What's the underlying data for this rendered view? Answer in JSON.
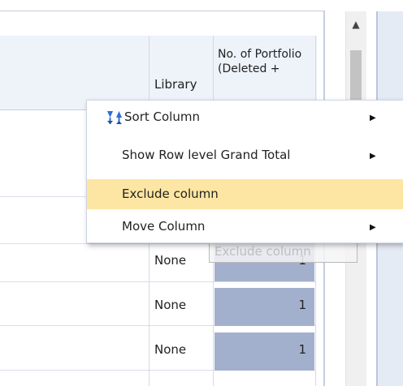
{
  "table": {
    "headers": {
      "library": "Library",
      "portfolio": "No. of Portfolio (Deleted +"
    },
    "rows": [
      {
        "library": "None",
        "value": "1"
      },
      {
        "library": "None",
        "value": "1"
      },
      {
        "library": "None",
        "value": "1"
      }
    ]
  },
  "context_menu": {
    "items": [
      {
        "label": "Sort Column",
        "icon": "sort-icon",
        "has_submenu": true
      },
      {
        "label": "Show Row level Grand Total",
        "has_submenu": true
      },
      {
        "label": "Exclude column",
        "has_submenu": false,
        "highlighted": true
      },
      {
        "label": "Move Column",
        "has_submenu": true
      }
    ],
    "submenu_arrow": "▶"
  },
  "tooltip": {
    "text": "Exclude column"
  },
  "scrollbar": {
    "up_arrow": "▲"
  },
  "colors": {
    "highlight": "#fde6a3",
    "selected_cell": "#a3b0cd",
    "header_bg": "#eef2f9",
    "sort_icon_blue": "#2f6fd1"
  }
}
